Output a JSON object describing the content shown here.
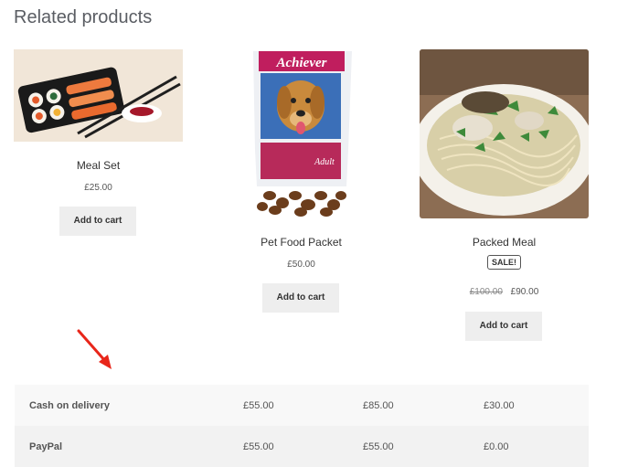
{
  "heading": "Related products",
  "products": [
    {
      "name": "Meal Set",
      "price": "£25.00",
      "button": "Add to cart",
      "image": "sushi-meal-set-photo"
    },
    {
      "name": "Pet Food Packet",
      "price": "£50.00",
      "button": "Add to cart",
      "image": "dog-food-packet-photo",
      "pack_label": "Achiever",
      "pack_sub": "Adult"
    },
    {
      "name": "Packed Meal",
      "badge": "SALE!",
      "old_price": "£100.00",
      "price": "£90.00",
      "button": "Add to cart",
      "image": "noodle-soup-photo"
    }
  ],
  "annotation": {
    "icon": "red-arrow-icon",
    "color": "#e8261a"
  },
  "payment_table": {
    "rows": [
      {
        "method": "Cash on delivery",
        "values": [
          "£55.00",
          "£85.00",
          "£30.00"
        ]
      },
      {
        "method": "PayPal",
        "values": [
          "£55.00",
          "£55.00",
          "£0.00"
        ]
      }
    ]
  }
}
